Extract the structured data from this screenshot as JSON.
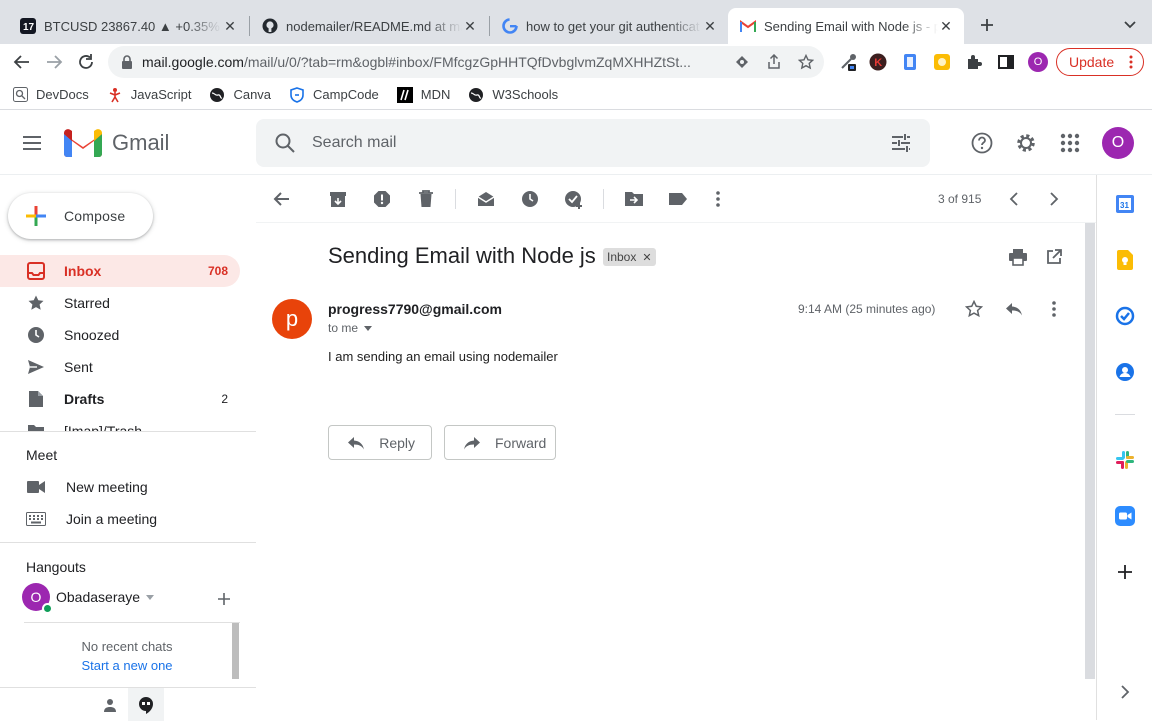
{
  "browser": {
    "tabs": [
      {
        "title": "BTCUSD 23867.40 ▲ +0.35% "
      },
      {
        "title": "nodemailer/README.md at master"
      },
      {
        "title": "how to get your git authenticat"
      },
      {
        "title": "Sending Email with Node js - pr"
      }
    ],
    "url_host": "mail.google.com",
    "url_path": "/mail/u/0/?tab=rm&ogbl#inbox/FMfcgzGpHHTQfDvbglvmZqMXHHZtSt...",
    "profile_initial": "O",
    "update_label": "Update",
    "bookmarks": [
      {
        "label": "DevDocs"
      },
      {
        "label": "JavaScript"
      },
      {
        "label": "Canva"
      },
      {
        "label": "CampCode"
      },
      {
        "label": "MDN"
      },
      {
        "label": "W3Schools"
      }
    ]
  },
  "gmail": {
    "brand": "Gmail",
    "search_placeholder": "Search mail",
    "account_initial": "O"
  },
  "sidebar": {
    "compose_label": "Compose",
    "items": [
      {
        "label": "Inbox",
        "count": "708"
      },
      {
        "label": "Starred",
        "count": ""
      },
      {
        "label": "Snoozed",
        "count": ""
      },
      {
        "label": "Sent",
        "count": ""
      },
      {
        "label": "Drafts",
        "count": "2"
      },
      {
        "label": "[Imap]/Trash",
        "count": ""
      }
    ],
    "meet": {
      "title": "Meet",
      "new_meeting": "New meeting",
      "join_meeting": "Join a meeting"
    },
    "hangouts": {
      "title": "Hangouts",
      "user_initial": "O",
      "user_name": "Obadaseraye",
      "no_chats": "No recent chats",
      "start_new": "Start a new one"
    }
  },
  "message": {
    "pager": "3 of 915",
    "subject": "Sending Email with Node js",
    "label_chip": "Inbox",
    "sender_initial": "p",
    "sender": "progress7790@gmail.com",
    "to": "to me",
    "time": "9:14 AM (25 minutes ago)",
    "body": "I am sending an email using nodemailer",
    "reply_label": "Reply",
    "forward_label": "Forward"
  },
  "colors": {
    "accent_red": "#d93025",
    "inbox_active_bg": "#fce8e6",
    "avatar_purple": "#9c27b0",
    "sender_avatar": "#e8430a",
    "link_blue": "#1a73e8"
  }
}
